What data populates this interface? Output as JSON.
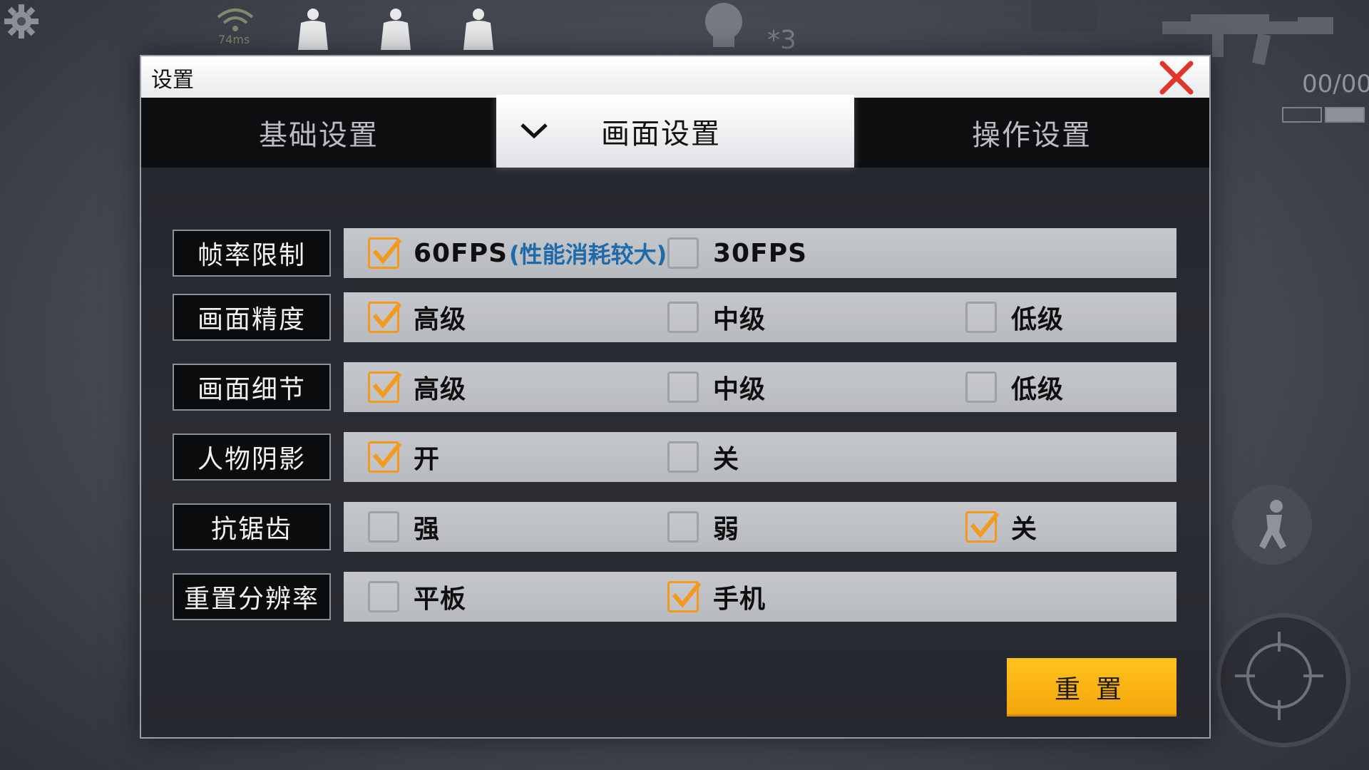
{
  "hud": {
    "wifi_text": "74ms",
    "kill_count": "*3",
    "ammo": "00/00"
  },
  "dialog": {
    "title": "设置",
    "tabs": [
      {
        "label": "基础设置",
        "active": false
      },
      {
        "label": "画面设置",
        "active": true
      },
      {
        "label": "操作设置",
        "active": false
      }
    ],
    "rows": [
      {
        "label": "帧率限制",
        "options": [
          {
            "label": "60FPS",
            "note": "(性能消耗较大)",
            "checked": true
          },
          {
            "label": "30FPS",
            "checked": false
          }
        ]
      },
      {
        "label": "画面精度",
        "options": [
          {
            "label": "高级",
            "checked": true
          },
          {
            "label": "中级",
            "checked": false
          },
          {
            "label": "低级",
            "checked": false
          }
        ]
      },
      {
        "label": "画面细节",
        "options": [
          {
            "label": "高级",
            "checked": true
          },
          {
            "label": "中级",
            "checked": false
          },
          {
            "label": "低级",
            "checked": false
          }
        ]
      },
      {
        "label": "人物阴影",
        "options": [
          {
            "label": "开",
            "checked": true
          },
          {
            "label": "关",
            "checked": false
          }
        ]
      },
      {
        "label": "抗锯齿",
        "options": [
          {
            "label": "强",
            "checked": false
          },
          {
            "label": "弱",
            "checked": false
          },
          {
            "label": "关",
            "checked": true
          }
        ]
      },
      {
        "label": "重置分辨率",
        "options": [
          {
            "label": "平板",
            "checked": false
          },
          {
            "label": "手机",
            "checked": true
          }
        ]
      }
    ],
    "reset_label": "重置"
  },
  "colors": {
    "accent_orange": "#f39a1e",
    "reset_yellow": "#ffb816",
    "note_blue": "#1f6aa8",
    "close_red": "#e0352b"
  }
}
